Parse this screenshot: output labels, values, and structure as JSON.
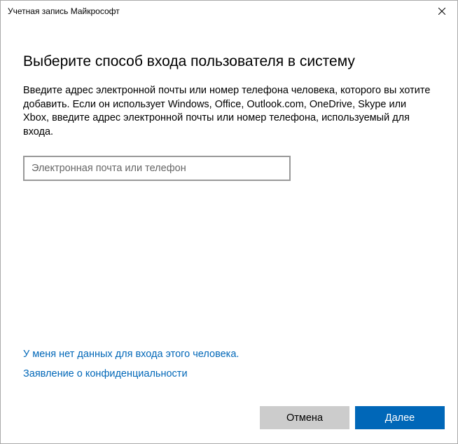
{
  "titlebar": {
    "title": "Учетная запись Майкрософт"
  },
  "content": {
    "heading": "Выберите способ входа пользователя в систему",
    "description": "Введите адрес электронной почты или номер телефона человека, которого вы хотите добавить. Если он использует Windows, Office, Outlook.com, OneDrive, Skype или Xbox, введите адрес электронной почты или номер телефона, используемый для входа.",
    "input_placeholder": "Электронная почта или телефон"
  },
  "links": {
    "no_info": "У меня нет данных для входа этого человека.",
    "privacy": "Заявление о конфиденциальности"
  },
  "buttons": {
    "cancel": "Отмена",
    "next": "Далее"
  }
}
